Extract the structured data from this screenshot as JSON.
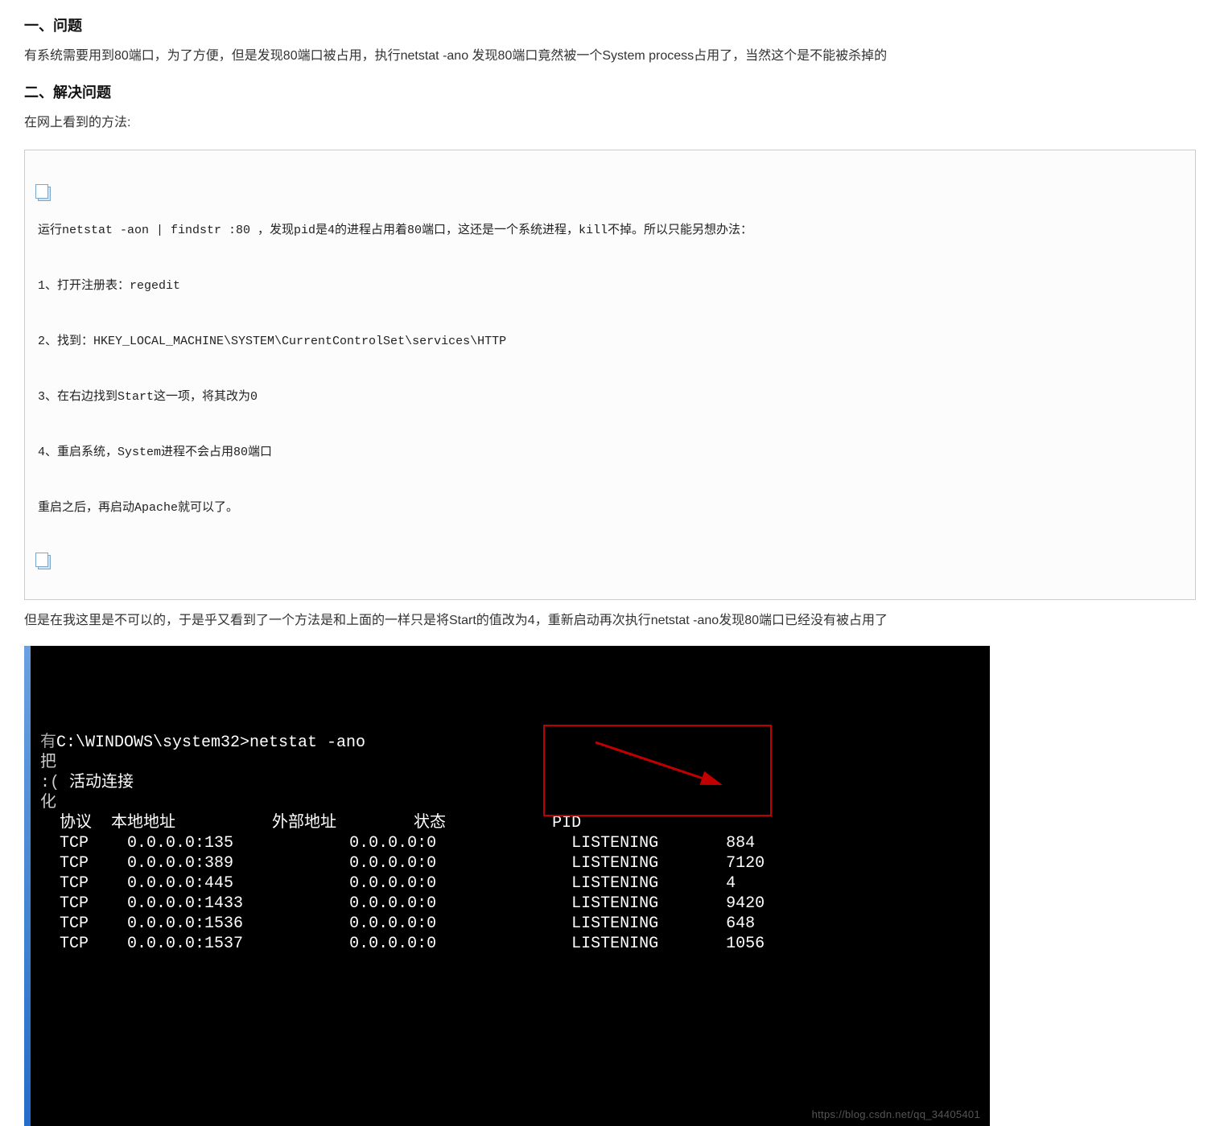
{
  "headings": {
    "h1": "一、问题",
    "h2": "二、解决问题"
  },
  "paragraphs": {
    "p1": "有系统需要用到80端口，为了方便，但是发现80端口被占用，执行netstat -ano 发现80端口竟然被一个System process占用了，当然这个是不能被杀掉的",
    "p2": "在网上看到的方法:",
    "p3": "但是在我这里是不可以的，于是乎又看到了一个方法是和上面的一样只是将Start的值改为4，重新启动再次执行netstat -ano发现80端口已经没有被占用了"
  },
  "code_block": {
    "l1": "运行netstat -aon | findstr :80 ，发现pid是4的进程占用着80端口，这还是一个系统进程，kill不掉。所以只能另想办法：",
    "l2": "1、打开注册表：regedit",
    "l3": "2、找到：HKEY_LOCAL_MACHINE\\SYSTEM\\CurrentControlSet\\services\\HTTP",
    "l4": "3、在右边找到Start这一项，将其改为0",
    "l5": "4、重启系统，System进程不会占用80端口",
    "l6": "重启之后，再启动Apache就可以了。"
  },
  "terminal": {
    "prompt_line": "C:\\WINDOWS\\system32>netstat -ano",
    "active_conn": "活动连接",
    "header": "  协议  本地地址          外部地址        状态           PID",
    "rows": [
      "  TCP    0.0.0.0:135            0.0.0.0:0              LISTENING       884",
      "  TCP    0.0.0.0:389            0.0.0.0:0              LISTENING       7120",
      "  TCP    0.0.0.0:445            0.0.0.0:0              LISTENING       4",
      "  TCP    0.0.0.0:1433           0.0.0.0:0              LISTENING       9420",
      "  TCP    0.0.0.0:1536           0.0.0.0:0              LISTENING       648",
      "  TCP    0.0.0.0:1537           0.0.0.0:0              LISTENING       1056"
    ],
    "watermark": "https://blog.csdn.net/qq_34405401"
  }
}
